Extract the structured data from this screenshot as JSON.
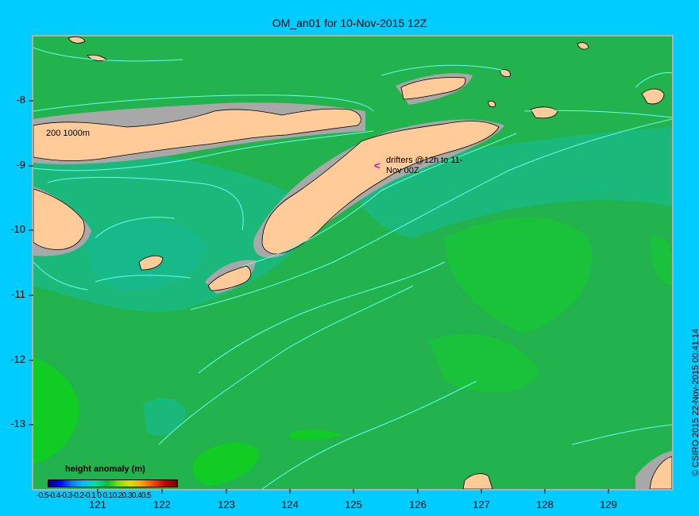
{
  "title": "OM_an01 for 10-Nov-2015 12Z",
  "credit": "© CSIRO 2015   22-Nov-2015 00:41:14",
  "isobath_label": "200  1000m",
  "drifter_label": "drifters @12h to 11-Nov 00Z",
  "drifter_marker": "<",
  "y_axis_labels": [
    "-8",
    "-9",
    "-10",
    "-11",
    "-12",
    "-13"
  ],
  "x_axis_labels": [
    "121",
    "122",
    "123",
    "124",
    "125",
    "126",
    "127",
    "128",
    "129"
  ],
  "legend": {
    "title": "height anomaly (m)",
    "ticks": "-0.5-0.4-0.3-0.2-0.1  0  0.10.20.30.40.5"
  },
  "colors": {
    "background": "#00ccff",
    "sea_base": "#22b34e",
    "sea_high": "#11cc22",
    "sea_low": "#1ab87a",
    "land": "#ffcc99",
    "shelf": "#a8a8a8",
    "contour": "#66ffee",
    "drifter": "#cc00cc"
  }
}
